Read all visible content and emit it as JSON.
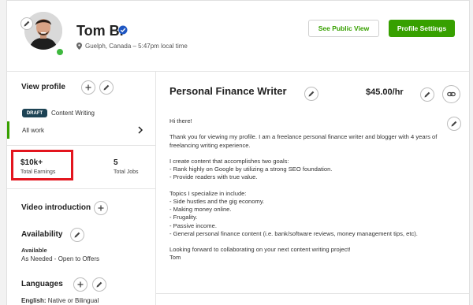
{
  "profile": {
    "name": "Tom B.",
    "location": "Guelph, Canada – 5:47pm local time"
  },
  "header": {
    "public_view_label": "See Public View",
    "settings_label": "Profile Settings"
  },
  "sidebar": {
    "view_profile_title": "View profile",
    "draft_badge": "DRAFT",
    "specialized_profile": "Content Writing",
    "all_work_label": "All work",
    "total_earnings_value": "$10k+",
    "total_earnings_label": "Total Earnings",
    "total_jobs_value": "5",
    "total_jobs_label": "Total Jobs",
    "video_intro_title": "Video introduction",
    "availability_title": "Availability",
    "availability_status": "Available",
    "availability_detail": "As Needed - Open to Offers",
    "languages_title": "Languages",
    "language_line": "English: Native or Bilingual",
    "language_name": "English:",
    "language_level": " Native or Bilingual"
  },
  "main": {
    "title": "Personal Finance Writer",
    "rate": "$45.00/hr",
    "overview": "Hi there!\n\nThank you for viewing my profile. I am a freelance personal finance writer and blogger with 4 years of freelancing writing experience.\n\nI create content that accomplishes two goals:\n- Rank highly on Google by utilizing a strong SEO foundation.\n- Provide readers with true value.\n\nTopics I specialize in include:\n- Side hustles and the gig economy.\n- Making money online.\n- Frugality.\n- Passive income.\n- General personal finance content (i.e. bank/software reviews, money management tips, etc).\n\nLooking forward to collaborating on your next content writing project!\nTom"
  },
  "colors": {
    "accent_green": "#37a000",
    "highlight_red": "#e3151e",
    "verified_blue": "#1f57c3"
  }
}
